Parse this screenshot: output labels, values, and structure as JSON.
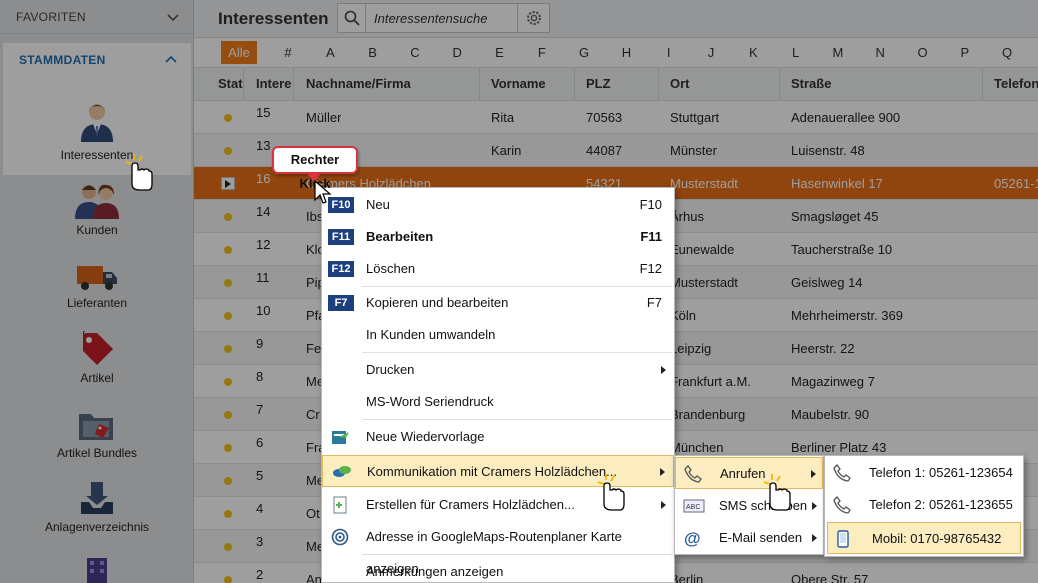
{
  "sidebar": {
    "favoriten": "FAVORITEN",
    "stammdaten": "STAMMDATEN",
    "items": [
      {
        "label": "Interessenten",
        "icon": "person-icon"
      },
      {
        "label": "Kunden",
        "icon": "people-icon"
      },
      {
        "label": "Lieferanten",
        "icon": "truck-icon"
      },
      {
        "label": "Artikel",
        "icon": "tag-icon"
      },
      {
        "label": "Artikel Bundles",
        "icon": "folder-tag-icon"
      },
      {
        "label": "Anlagenverzeichnis",
        "icon": "inbox-icon"
      }
    ]
  },
  "header": {
    "title": "Interessenten",
    "search_placeholder": "Interessentensuche"
  },
  "alphabet": {
    "all": "Alle",
    "letters": [
      "#",
      "A",
      "B",
      "C",
      "D",
      "E",
      "F",
      "G",
      "H",
      "I",
      "J",
      "K",
      "L",
      "M",
      "N",
      "O",
      "P",
      "Q"
    ]
  },
  "table": {
    "columns": [
      "Stat",
      "Intere",
      "Nachname/Firma",
      "Vorname",
      "PLZ",
      "Ort",
      "Straße",
      "Telefon"
    ],
    "rows": [
      {
        "id": "15",
        "name": "Müller",
        "vorname": "Rita",
        "plz": "70563",
        "ort": "Stuttgart",
        "strasse": "Adenauerallee 900",
        "telefon": ""
      },
      {
        "id": "13",
        "name": "",
        "vorname": "Karin",
        "plz": "44087",
        "ort": "Münster",
        "strasse": "Luisenstr. 48",
        "telefon": ""
      },
      {
        "id": "16",
        "name": "Cramers Holzlädchen",
        "vorname": "",
        "plz": "54321",
        "ort": "Musterstadt",
        "strasse": "Hasenwinkel 17",
        "telefon": "05261-1"
      },
      {
        "id": "14",
        "name": "Ibs",
        "vorname": "",
        "plz": "",
        "ort": "Århus",
        "strasse": "Smagsløget 45",
        "telefon": ""
      },
      {
        "id": "12",
        "name": "Klo",
        "vorname": "",
        "plz": "",
        "ort": "Eunewalde",
        "strasse": "Taucherstraße 10",
        "telefon": ""
      },
      {
        "id": "11",
        "name": "Pip",
        "vorname": "",
        "plz": "",
        "ort": "Musterstadt",
        "strasse": "Geislweg 14",
        "telefon": ""
      },
      {
        "id": "10",
        "name": "Pfa",
        "vorname": "",
        "plz": "",
        "ort": "Köln",
        "strasse": "Mehrheimerstr. 369",
        "telefon": ""
      },
      {
        "id": "9",
        "name": "Fe",
        "vorname": "",
        "plz": "",
        "ort": "Leipzig",
        "strasse": "Heerstr. 22",
        "telefon": ""
      },
      {
        "id": "8",
        "name": "Me",
        "vorname": "",
        "plz": "",
        "ort": "Frankfurt a.M.",
        "strasse": "Magazinweg 7",
        "telefon": ""
      },
      {
        "id": "7",
        "name": "Cr",
        "vorname": "",
        "plz": "",
        "ort": "Brandenburg",
        "strasse": "Maubelstr. 90",
        "telefon": ""
      },
      {
        "id": "6",
        "name": "Fra",
        "vorname": "",
        "plz": "",
        "ort": "München",
        "strasse": "Berliner Platz 43",
        "telefon": ""
      },
      {
        "id": "5",
        "name": "Me",
        "vorname": "",
        "plz": "",
        "ort": "",
        "strasse": "",
        "telefon": ""
      },
      {
        "id": "4",
        "name": "Ot",
        "vorname": "",
        "plz": "",
        "ort": "",
        "strasse": "",
        "telefon": ""
      },
      {
        "id": "3",
        "name": "Me",
        "vorname": "",
        "plz": "",
        "ort": "",
        "strasse": "",
        "telefon": ""
      },
      {
        "id": "2",
        "name": "An",
        "vorname": "",
        "plz": "",
        "ort": "Berlin",
        "strasse": "Obere Str. 57",
        "telefon": ""
      }
    ]
  },
  "context_menu": {
    "items": [
      {
        "key": "F10",
        "label": "Neu",
        "shortcut": "F10"
      },
      {
        "key": "F11",
        "label": "Bearbeiten",
        "shortcut": "F11"
      },
      {
        "key": "F12",
        "label": "Löschen",
        "shortcut": "F12"
      },
      {
        "key": "F7",
        "label": "Kopieren und bearbeiten",
        "shortcut": "F7"
      },
      {
        "label": "In Kunden umwandeln"
      },
      {
        "label": "Drucken"
      },
      {
        "label": "MS-Word Seriendruck"
      },
      {
        "label": "Neue Wiedervorlage",
        "icon": "reminder-icon"
      },
      {
        "label": "Kommunikation mit Cramers Holzlädchen...",
        "icon": "chat-icon"
      },
      {
        "label": "Erstellen für Cramers Holzlädchen...",
        "icon": "document-add-icon"
      },
      {
        "label": "Adresse in GoogleMaps-Routenplaner Karte anzeigen",
        "icon": "target-icon"
      },
      {
        "label": "Anmerkungen anzeigen"
      }
    ]
  },
  "submenu_communication": [
    {
      "label": "Anrufen",
      "icon": "phone-icon"
    },
    {
      "label": "SMS schreiben",
      "icon": "sms-icon"
    },
    {
      "label": "E-Mail senden",
      "icon": "at-icon"
    }
  ],
  "submenu_call": [
    {
      "label": "Telefon 1: 05261-123654",
      "icon": "phone-icon"
    },
    {
      "label": "Telefon 2: 05261-123655",
      "icon": "phone-icon"
    },
    {
      "label": "Mobil: 0170-98765432",
      "icon": "mobile-icon"
    }
  ],
  "callout": "Rechter Klick",
  "colors": {
    "accent": "#ea7017",
    "highlight": "#fcedc1",
    "brand": "#1f6fb2",
    "status_dot": "#f2c318"
  }
}
